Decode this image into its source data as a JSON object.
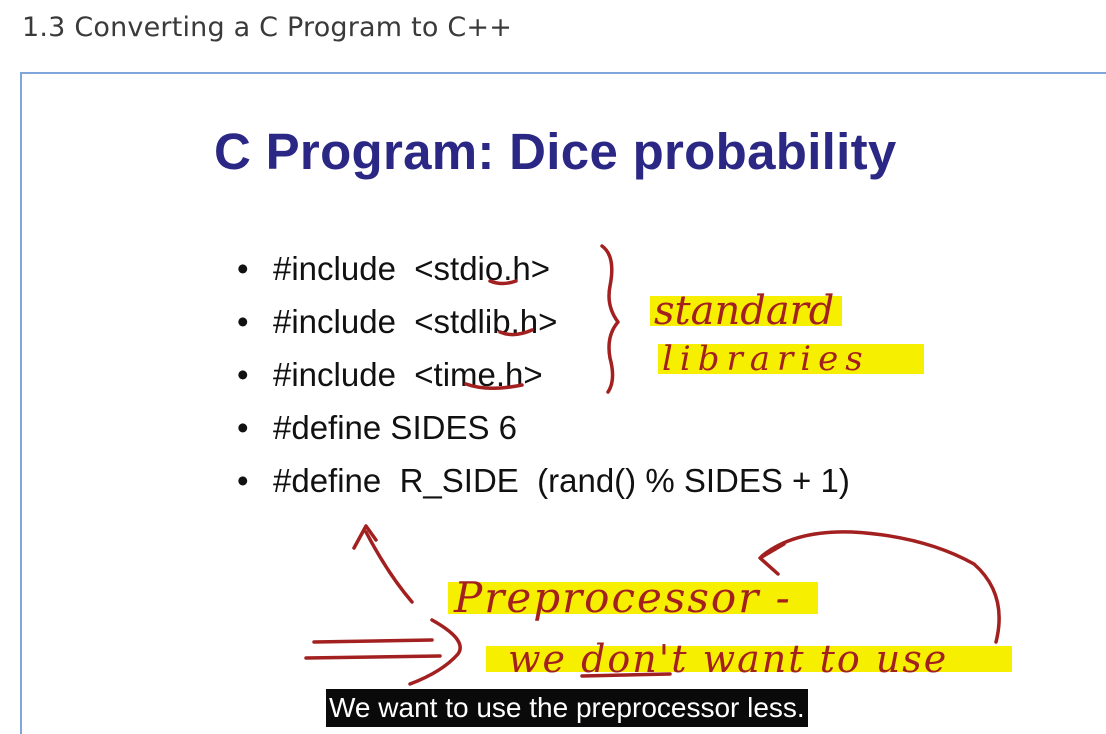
{
  "page": {
    "heading": "1.3 Converting a C Program to C++"
  },
  "slide": {
    "title": "C Program: Dice probability",
    "bullets": [
      "#include  <stdio.h>",
      "#include  <stdlib.h>",
      "#include  <time.h>",
      "#define SIDES 6",
      "#define  R_SIDE  (rand() % SIDES + 1)"
    ],
    "bullet_marker": "•"
  },
  "annotations": {
    "note_standard": "standard",
    "note_libraries": "libraries",
    "note_preprocessor": "Preprocessor -",
    "note_dont_want": "we don't want to use",
    "highlight_color": "#f7ef00",
    "ink_color": "#a32020"
  },
  "video": {
    "subtitle": "We want to use the preprocessor less."
  }
}
